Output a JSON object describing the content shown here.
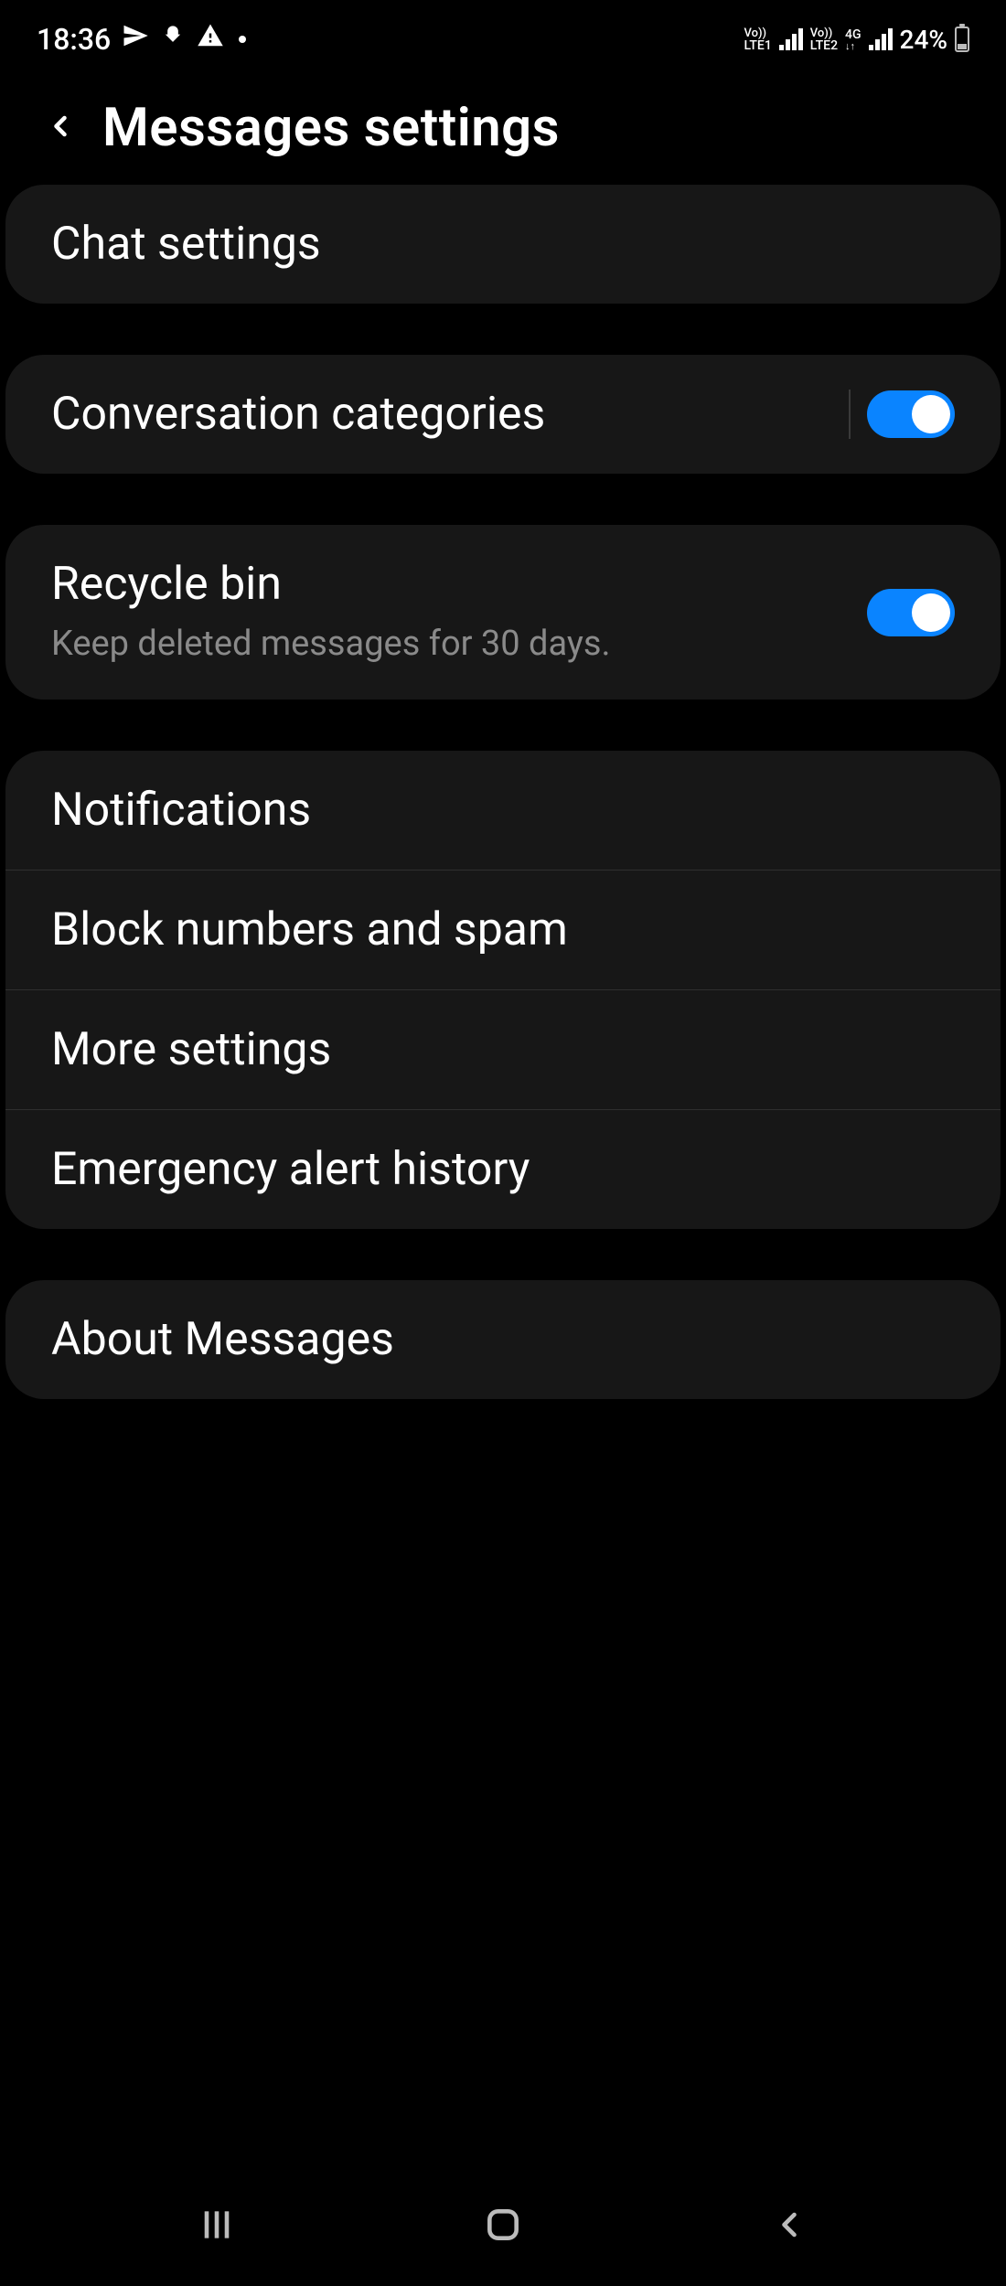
{
  "status": {
    "time": "18:36",
    "lte1": "LTE1",
    "lte1_vo": "Vo))",
    "lte2": "LTE2",
    "lte2_vo": "Vo))",
    "network": "4G",
    "battery": "24%"
  },
  "header": {
    "title": "Messages settings"
  },
  "cards": {
    "chat": {
      "title": "Chat settings"
    },
    "categories": {
      "title": "Conversation categories",
      "toggle": true
    },
    "recycle": {
      "title": "Recycle bin",
      "subtitle": "Keep deleted messages for 30 days.",
      "toggle": true
    },
    "group": {
      "notifications": "Notifications",
      "block": "Block numbers and spam",
      "more": "More settings",
      "emergency": "Emergency alert history"
    },
    "about": {
      "title": "About Messages"
    }
  }
}
